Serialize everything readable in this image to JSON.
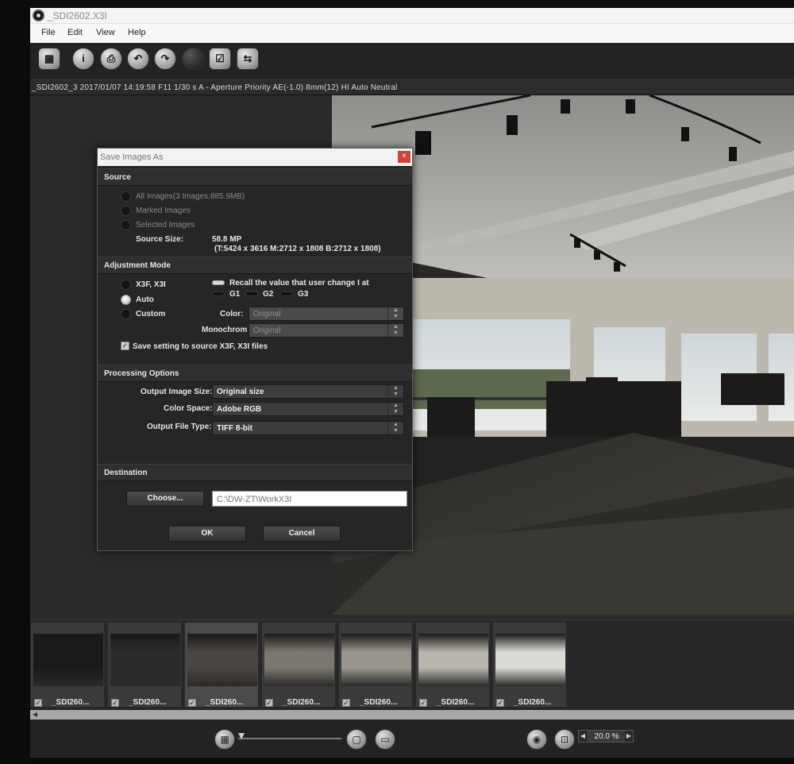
{
  "window": {
    "title": "_SDI2602.X3I"
  },
  "menu": [
    "File",
    "Edit",
    "View",
    "Help"
  ],
  "toolbar": {
    "buttons": [
      {
        "name": "save-tiff",
        "glyph": "▦"
      },
      {
        "name": "info",
        "glyph": "i"
      },
      {
        "name": "print",
        "glyph": "⎙"
      },
      {
        "name": "rotate-left",
        "glyph": "↶"
      },
      {
        "name": "rotate-right",
        "glyph": "↷"
      },
      {
        "name": "x3f",
        "glyph": ""
      },
      {
        "name": "check",
        "glyph": "☑"
      },
      {
        "name": "sync",
        "glyph": "⇆"
      }
    ]
  },
  "infobar": {
    "text": "_SDI2602_3 2017/01/07 14:19:58 F11 1/30 s A - Aperture Priority AE(-1.0) 8mm(12) HI Auto Neutral"
  },
  "dialog": {
    "title": "Save Images As",
    "close": "×",
    "source": {
      "heading": "Source",
      "options": [
        "All Images(3 Images,885.9MB)",
        "Marked Images",
        "Selected Images"
      ],
      "size_label": "Source Size:",
      "size_value": "58.8 MP",
      "size_detail": "(T:5424 x 3616  M:2712 x 1808  B:2712 x 1808)"
    },
    "adjustment": {
      "heading": "Adjustment Mode",
      "modes": [
        "X3F, X3I",
        "Auto",
        "Custom"
      ],
      "selected_mode": "Auto",
      "recall_label": "Recall the value that user change I at",
      "groups": [
        "G1",
        "G2",
        "G3"
      ],
      "color_label": "Color:",
      "color_value": "Original",
      "mono_label": "Monochrom",
      "mono_value": "Original",
      "save_setting_label": "Save setting to source X3F, X3I files",
      "save_setting_checked": true
    },
    "processing": {
      "heading": "Processing Options",
      "size_label": "Output Image Size:",
      "size_value": "Original size",
      "space_label": "Color Space:",
      "space_value": "Adobe RGB",
      "type_label": "Output File Type:",
      "type_value": "TIFF 8-bit"
    },
    "destination": {
      "heading": "Destination",
      "choose_label": "Choose...",
      "path": "C:\\DW-ZT\\WorkX3I"
    },
    "ok_label": "OK",
    "cancel_label": "Cancel"
  },
  "thumbnails": [
    {
      "label": "_SDI260...",
      "tone": "#1a1a1a"
    },
    {
      "label": "_SDI260...",
      "tone": "#2c2c2c"
    },
    {
      "label": "_SDI260...",
      "tone": "#4a4540"
    },
    {
      "label": "_SDI260...",
      "tone": "#7c776f"
    },
    {
      "label": "_SDI260...",
      "tone": "#9a958c"
    },
    {
      "label": "_SDI260...",
      "tone": "#b9b6ae"
    },
    {
      "label": "_SDI260...",
      "tone": "#dcdad4"
    }
  ],
  "bottom": {
    "zoom": "20.0 %"
  }
}
